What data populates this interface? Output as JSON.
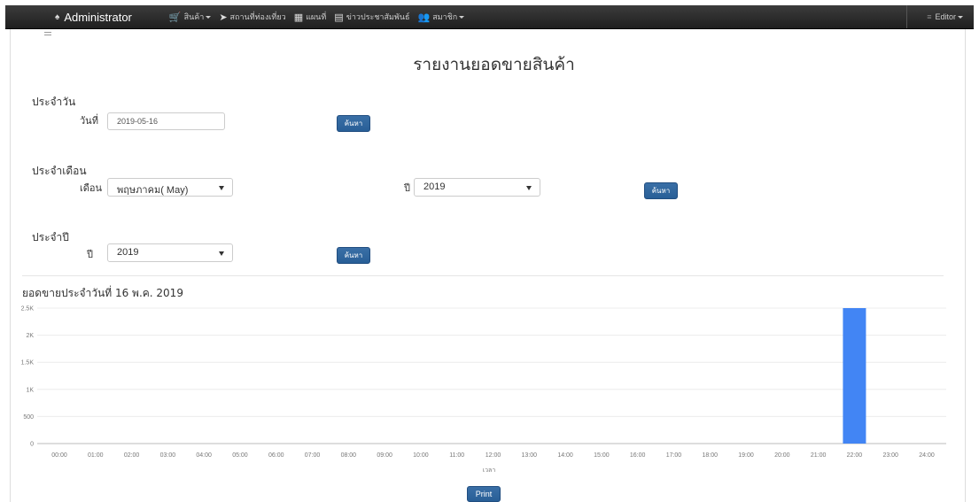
{
  "navbar": {
    "brand": "Administrator",
    "items": [
      {
        "icon": "cart-icon",
        "glyph": "🛒",
        "label": "สินค้า",
        "dropdown": true
      },
      {
        "icon": "location-arrow-icon",
        "glyph": "➤",
        "label": "สถานที่ท่องเที่ยว",
        "dropdown": false
      },
      {
        "icon": "map-icon",
        "glyph": "▦",
        "label": "แผนที่",
        "dropdown": false
      },
      {
        "icon": "news-icon",
        "glyph": "▤",
        "label": "ข่าวประชาสัมพันธ์",
        "dropdown": false
      },
      {
        "icon": "users-icon",
        "glyph": "👥",
        "label": "สมาชิก",
        "dropdown": true
      }
    ],
    "user": "Editor"
  },
  "page_title": "รายงานยอดขายสินค้า",
  "daily": {
    "title": "ประจำวัน",
    "date_label": "วันที่",
    "date_value": "2019-05-16",
    "search_label": "ค้นหา"
  },
  "monthly": {
    "title": "ประจำเดือน",
    "month_label": "เดือน",
    "month_value": "พฤษภาคม( May)",
    "year_label": "ปี",
    "year_value": "2019",
    "search_label": "ค้นหา"
  },
  "yearly": {
    "title": "ประจำปี",
    "year_label": "ปี",
    "year_value": "2019",
    "search_label": "ค้นหา"
  },
  "chart_data": {
    "type": "bar",
    "title": "ยอดขายประจำวันที่ 16 พ.ค. 2019",
    "xlabel": "เวลา",
    "ylabel": "",
    "ylim": [
      0,
      2500
    ],
    "yticks": [
      "0",
      "500",
      "1K",
      "1.5K",
      "2K",
      "2.5K"
    ],
    "yticks_values": [
      0,
      500,
      1000,
      1500,
      2000,
      2500
    ],
    "categories": [
      "00:00",
      "01:00",
      "02:00",
      "03:00",
      "04:00",
      "05:00",
      "06:00",
      "07:00",
      "08:00",
      "09:00",
      "10:00",
      "11:00",
      "12:00",
      "13:00",
      "14:00",
      "15:00",
      "16:00",
      "17:00",
      "18:00",
      "19:00",
      "20:00",
      "21:00",
      "22:00",
      "23:00",
      "24:00"
    ],
    "values": [
      0,
      0,
      0,
      0,
      0,
      0,
      0,
      0,
      0,
      0,
      0,
      0,
      0,
      0,
      0,
      0,
      0,
      0,
      0,
      0,
      0,
      0,
      2500,
      0,
      0
    ],
    "bar_color": "#4285f4",
    "grid": true,
    "legend": "none"
  },
  "print_label": "Print"
}
